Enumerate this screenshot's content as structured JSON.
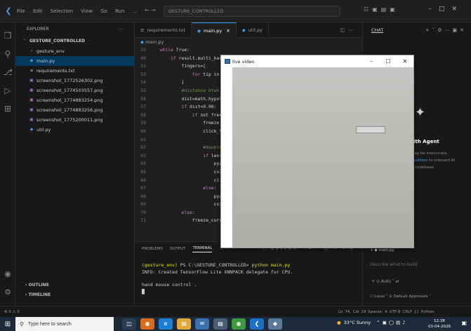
{
  "titlebar": {
    "menu": [
      "File",
      "Edit",
      "Selection",
      "View",
      "Go",
      "Run",
      "…"
    ],
    "search": "GESTURE_CONTROLLED",
    "nav": "← →"
  },
  "sidebar": {
    "title": "EXPLORER",
    "folder": "GESTURE_CONTROLLED",
    "items": [
      {
        "label": "gesture_env",
        "icon": "chevron-right-icon",
        "kind": "folder"
      },
      {
        "label": "main.py",
        "icon": "python-file-icon",
        "kind": "py"
      },
      {
        "label": "requirements.txt",
        "icon": "text-file-icon",
        "kind": "txt"
      },
      {
        "label": "screenshot_1772526302.png",
        "icon": "image-file-icon",
        "kind": "img"
      },
      {
        "label": "screenshot_1774503557.png",
        "icon": "image-file-icon",
        "kind": "img"
      },
      {
        "label": "screenshot_1774883254.png",
        "icon": "image-file-icon",
        "kind": "img"
      },
      {
        "label": "screenshot_1774883256.png",
        "icon": "image-file-icon",
        "kind": "img"
      },
      {
        "label": "screenshot_1775200011.png",
        "icon": "image-file-icon",
        "kind": "img"
      },
      {
        "label": "util.py",
        "icon": "python-file-icon",
        "kind": "py"
      }
    ],
    "outline": "OUTLINE",
    "timeline": "TIMELINE"
  },
  "tabs": [
    {
      "label": "requirements.txt",
      "active": false
    },
    {
      "label": "main.py",
      "active": true
    },
    {
      "label": "util.py",
      "active": false
    }
  ],
  "breadcrumb": "main.py",
  "code": [
    {
      "n": "32",
      "text": "  while True:"
    },
    {
      "n": "40",
      "text": "      if result.multi_han"
    },
    {
      "n": "51",
      "text": "          fingers=["
    },
    {
      "n": "53",
      "text": "              for tip in"
    },
    {
      "n": "54",
      "text": "          ]"
    },
    {
      "n": "55",
      "text": "          #distance btwn"
    },
    {
      "n": "56",
      "text": "          dist=math.hypot"
    },
    {
      "n": "57",
      "text": "          if dist<0.06:"
    },
    {
      "n": "58",
      "text": "              if not free"
    },
    {
      "n": "59",
      "text": "                  freeze_"
    },
    {
      "n": "60",
      "text": "                  click_t"
    },
    {
      "n": "61",
      "text": ""
    },
    {
      "n": "62",
      "text": "                  #double"
    },
    {
      "n": "63",
      "text": "                  if len("
    },
    {
      "n": "64",
      "text": "                      pya"
    },
    {
      "n": "65",
      "text": "                      cv2"
    },
    {
      "n": "66",
      "text": "                      cli"
    },
    {
      "n": "67",
      "text": "                  else:"
    },
    {
      "n": "68",
      "text": "                      pya"
    },
    {
      "n": "69",
      "text": "                      cv2"
    },
    {
      "n": "70",
      "text": "          else:"
    },
    {
      "n": "71",
      "text": "              freeze_curs"
    }
  ],
  "panel": {
    "tabs": [
      "PROBLEMS",
      "OUTPUT",
      "TERMINAL",
      "…"
    ],
    "active_tab": "TERMINAL",
    "shell": "python",
    "terminal": {
      "env": "(gesture_env)",
      "prompt": " PS C:\\GESTURE_CONTROLLED> ",
      "command": "python main.py",
      "line2": "INFO: Created TensorFlow Lite XNNPACK delegate for CPU.",
      "line3": "hand mouse control .",
      "cursor": "█"
    }
  },
  "video_window": {
    "title": "live video",
    "minimize": "–",
    "maximize": "☐",
    "close": "✕"
  },
  "chat": {
    "title": "CHAT",
    "agent_title": "ith Agent",
    "msg1": "nay be inaccurate",
    "msg2_link": "ructions",
    "msg2_rest": " to onboard AI",
    "msg3": "r codebase.",
    "context": "+ ◆ main.py",
    "input_placeholder": "Describe what to build",
    "tools": "+  ⊙  Auto ˅  ⇄",
    "mode": "☐ Local ˅   ⊙ Default Approvals ˅"
  },
  "statusbar": {
    "left": "⊗ 0 ⚠ 0",
    "right": "Ln 74, Col 19   Spaces: 4   UTF-8   CRLF   {} Python"
  },
  "taskbar": {
    "search": "Type here to search",
    "weather": "33°C  Sunny",
    "time": "12:38",
    "date": "03-04-2026"
  }
}
